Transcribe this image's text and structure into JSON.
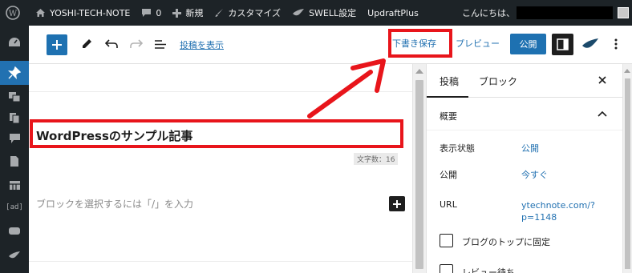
{
  "admin_bar": {
    "site_name": "YOSHI-TECH-NOTE",
    "comments_count": "0",
    "new_label": "新規",
    "customize_label": "カスタマイズ",
    "swell_label": "SWELL設定",
    "updraft_label": "UpdraftPlus",
    "greeting": "こんにちは、"
  },
  "header": {
    "view_post_link": "投稿を表示",
    "save_draft_label": "下書き保存",
    "preview_label": "プレビュー",
    "publish_label": "公開"
  },
  "editor": {
    "post_title": "WordPressのサンプル記事",
    "char_count": "文字数：16",
    "block_placeholder": "ブロックを選択するには「/」を入力"
  },
  "admin_menu": {
    "ad_label": "[ad]"
  },
  "sidebar": {
    "tabs": [
      {
        "label": "投稿",
        "active": true
      },
      {
        "label": "ブロック",
        "active": false
      }
    ],
    "panel_title": "概要",
    "visibility_label": "表示状態",
    "visibility_value": "公開",
    "publish_label": "公開",
    "publish_value": "今すぐ",
    "url_label": "URL",
    "url_value": "ytechnote.com/?p=1148",
    "sticky_label": "ブログのトップに固定",
    "pending_label": "レビュー待ち"
  },
  "colors": {
    "admin_bar_bg": "#1d2327",
    "accent_blue": "#1e71b1",
    "link_blue": "#2271b1",
    "annotation_red": "#e8151b"
  },
  "icons": [
    "wordpress-logo-icon",
    "home-icon",
    "comment-icon",
    "plus-icon",
    "brush-icon",
    "swell-bird-icon",
    "pencil-icon",
    "undo-icon",
    "redo-icon",
    "list-view-icon",
    "settings-panel-icon",
    "more-vertical-icon",
    "close-icon",
    "chevron-up-icon"
  ]
}
